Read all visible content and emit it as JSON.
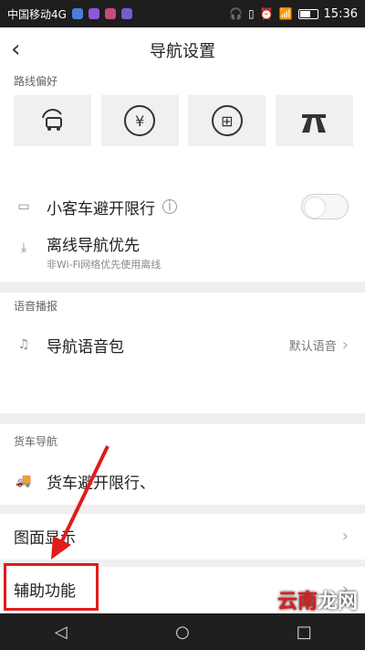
{
  "status": {
    "carrier": "中国移动4G",
    "time": "15:36"
  },
  "header": {
    "title": "导航设置",
    "back_icon": "chevron-left-icon"
  },
  "sections": {
    "route_pref": "路线偏好",
    "voice": "语音播报",
    "truck": "货车导航"
  },
  "route_buttons": [
    {
      "icon": "avoid-congestion-icon"
    },
    {
      "icon": "avoid-fee-icon"
    },
    {
      "icon": "avoid-highway-toll-icon"
    },
    {
      "icon": "highway-first-icon"
    }
  ],
  "items": {
    "car_restrict": "小客车避开限行",
    "offline_nav": "离线导航优先",
    "offline_sub": "非Wi-Fi网络优先使用离线",
    "voice_pack": "导航语音包",
    "voice_default": "默认语音",
    "truck_restrict": "货车避开限行、",
    "display": "图面显示",
    "assist": "辅助功能"
  },
  "watermark": {
    "a": "云南",
    "b": "龙网"
  },
  "colors": {
    "highlight": "#e21b1b"
  }
}
